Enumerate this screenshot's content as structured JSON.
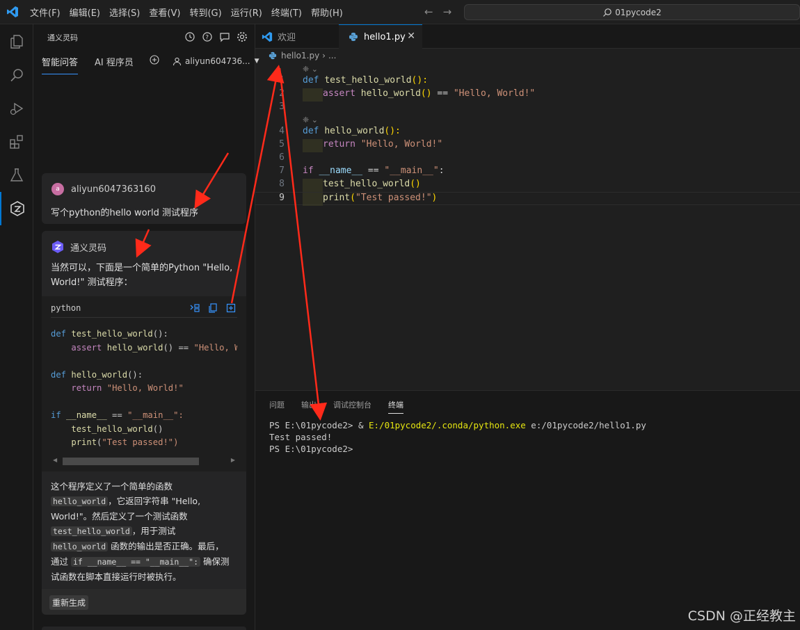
{
  "titlebar": {
    "menu": [
      "文件(F)",
      "编辑(E)",
      "选择(S)",
      "查看(V)",
      "转到(G)",
      "运行(R)",
      "终端(T)",
      "帮助(H)"
    ],
    "search_text": "01pycode2"
  },
  "sidebar": {
    "title": "通义灵码",
    "tabs": [
      "智能问答",
      "AI 程序员"
    ],
    "user": "aliyun604736...",
    "user_message": {
      "avatar_letter": "a",
      "name": "aliyun6047363160",
      "text": "写个python的hello world 测试程序"
    },
    "assistant": {
      "name": "通义灵码",
      "intro": "当然可以，下面是一个简单的Python \"Hello, World!\" 测试程序：",
      "code_lang": "python",
      "code_lines": [
        "def test_hello_world():",
        "    assert hello_world() == \"Hello, Wo",
        "",
        "def hello_world():",
        "    return \"Hello, World!\"",
        "",
        "if __name__ == \"__main__\":",
        "    test_hello_world()",
        "    print(\"Test passed!\")"
      ],
      "explain_1": "这个程序定义了一个简单的函数",
      "code_hello_world": "hello_world",
      "explain_2": "，它返回字符串 \"Hello,",
      "explain_3": "World!\"。然后定义了一个测试函数",
      "code_test_hello_world": "test_hello_world",
      "explain_4": "，用于测试",
      "explain_5": "函数的输出是否正确。最后，",
      "explain_6": "通过",
      "code_if_main": "if __name__ == \"__main__\":",
      "explain_7": "确保测",
      "explain_8": "试函数在脚本直接运行时被执行。",
      "regenerate": "重新生成"
    }
  },
  "editor": {
    "tabs": [
      "欢迎",
      "hello1.py"
    ],
    "breadcrumb": [
      "hello1.py",
      "..."
    ],
    "lines": [
      {
        "n": "1",
        "parts": [
          [
            "kw",
            "def "
          ],
          [
            "fn",
            "test_hello_world"
          ],
          [
            "pu",
            "():"
          ]
        ]
      },
      {
        "n": "2",
        "parts": [
          [
            "guide",
            ""
          ],
          [
            "kw2",
            "assert "
          ],
          [
            "fn",
            "hello_world"
          ],
          [
            "pu",
            "()"
          ],
          [
            "op",
            " == "
          ],
          [
            "st",
            "\"Hello, World!\""
          ]
        ]
      },
      {
        "n": "3",
        "parts": []
      },
      {
        "n": "4",
        "parts": [
          [
            "kw",
            "def "
          ],
          [
            "fn",
            "hello_world"
          ],
          [
            "pu",
            "():"
          ]
        ]
      },
      {
        "n": "5",
        "parts": [
          [
            "guide",
            ""
          ],
          [
            "kw2",
            "return "
          ],
          [
            "st",
            "\"Hello, World!\""
          ]
        ]
      },
      {
        "n": "6",
        "parts": []
      },
      {
        "n": "7",
        "parts": [
          [
            "kw2",
            "if "
          ],
          [
            "va",
            "__name__"
          ],
          [
            "op",
            " == "
          ],
          [
            "st",
            "\"__main__\""
          ],
          [
            "op",
            ":"
          ]
        ]
      },
      {
        "n": "8",
        "parts": [
          [
            "guide",
            ""
          ],
          [
            "fn",
            "test_hello_world"
          ],
          [
            "pu",
            "()"
          ]
        ]
      },
      {
        "n": "9",
        "parts": [
          [
            "guide",
            ""
          ],
          [
            "fn",
            "print"
          ],
          [
            "pu",
            "("
          ],
          [
            "st",
            "\"Test passed!\""
          ],
          [
            "pu",
            ")"
          ]
        ]
      }
    ]
  },
  "panel": {
    "tabs": [
      "问题",
      "输出",
      "调试控制台",
      "终端"
    ],
    "terminal": {
      "prompt1": "PS E:\\01pycode2> ",
      "cmd_amp": "& ",
      "cmd_exe": "E:/01pycode2/.conda/python.exe",
      "cmd_arg": " e:/01pycode2/hello1.py",
      "output": "Test passed!",
      "prompt2": "PS E:\\01pycode2>"
    }
  },
  "watermark": "CSDN @正经教主",
  "colors": {
    "accent": "#0078d4",
    "arrow": "#ff2a1a"
  }
}
